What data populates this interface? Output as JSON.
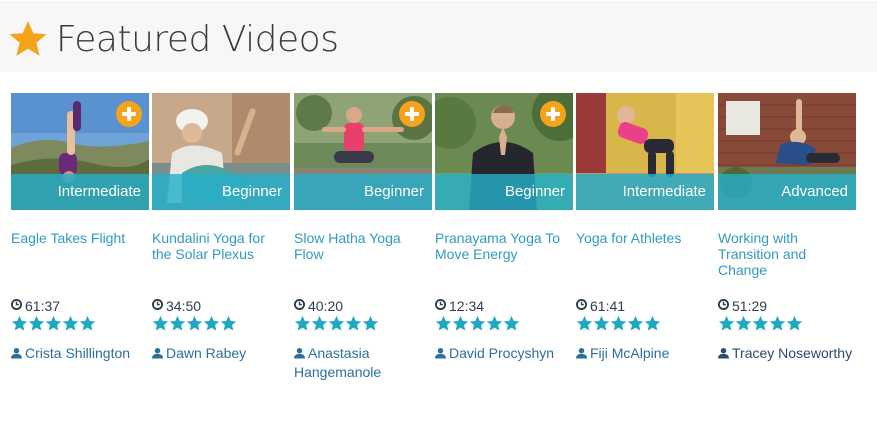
{
  "header": {
    "title": "Featured Videos",
    "icon": "star-icon",
    "icon_color": "#f5a31a"
  },
  "colors": {
    "accent": "#2f9bc0",
    "level_bar": "#26aec8",
    "add_button": "#f5a31a",
    "stars": "#1ea8c2"
  },
  "videos": [
    {
      "title": "Eagle Takes Flight",
      "level": "Intermediate",
      "duration": "61:37",
      "rating": 5,
      "author": "Crista Shillington",
      "has_add_button": true,
      "thumb": "rocky hillside, blue sky, inverted leg pose"
    },
    {
      "title": "Kundalini Yoga for the Solar Plexus",
      "level": "Beginner",
      "duration": "34:50",
      "rating": 5,
      "author": "Dawn Rabey",
      "has_add_button": false,
      "thumb": "woman in white turban, backbend"
    },
    {
      "title": "Slow Hatha Yoga Flow",
      "level": "Beginner",
      "duration": "40:20",
      "rating": 5,
      "author": "Anastasia Hangemanole",
      "has_add_button": true,
      "thumb": "woman in pink top, forest"
    },
    {
      "title": "Pranayama Yoga To Move Energy",
      "level": "Beginner",
      "duration": "12:34",
      "rating": 5,
      "author": "David Procyshyn",
      "has_add_button": true,
      "thumb": "man in black shirt, praying hands"
    },
    {
      "title": "Yoga for Athletes",
      "level": "Intermediate",
      "duration": "61:41",
      "rating": 5,
      "author": "Fiji McAlpine",
      "has_add_button": false,
      "thumb": "woman in pink, yellow room"
    },
    {
      "title": "Working with Transition and Change",
      "level": "Advanced",
      "duration": "51:29",
      "rating": 5,
      "author": "Tracey Noseworthy",
      "has_add_button": false,
      "thumb": "brick wall, side stretch"
    }
  ]
}
